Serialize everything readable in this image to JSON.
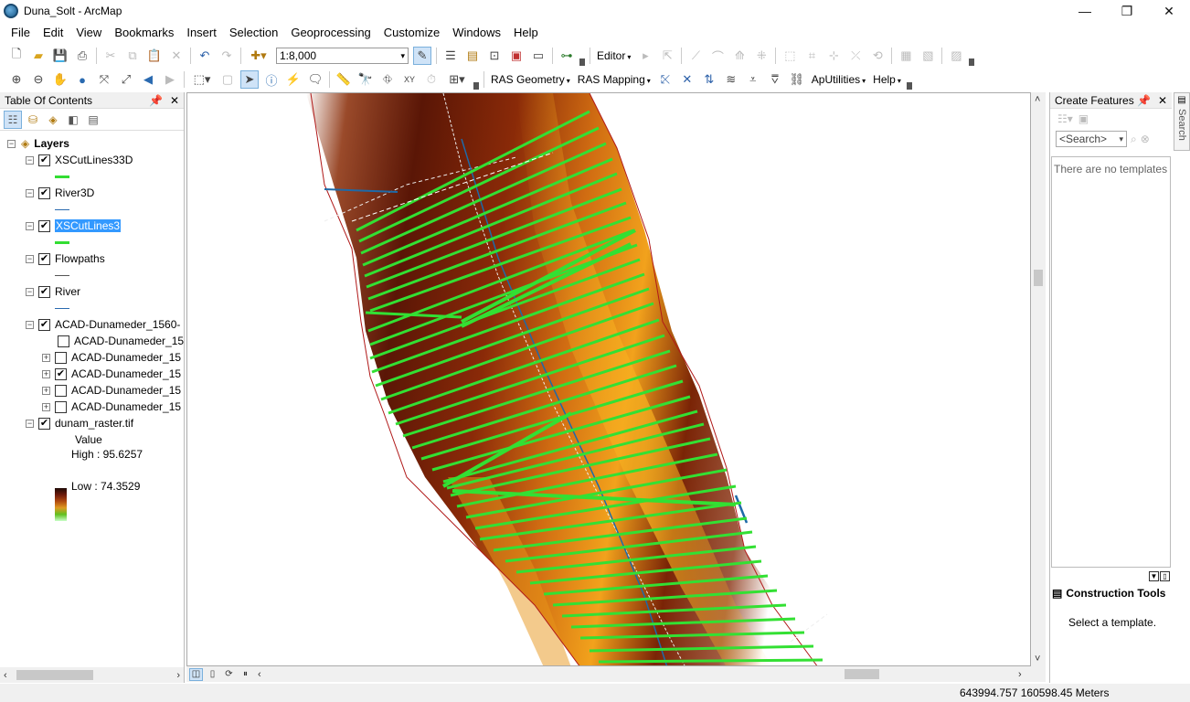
{
  "window": {
    "title": "Duna_Solt - ArcMap",
    "icon": "arcmap-globe-icon",
    "controls": {
      "minimize": "—",
      "maximize": "❐",
      "close": "✕"
    }
  },
  "menu": [
    "File",
    "Edit",
    "View",
    "Bookmarks",
    "Insert",
    "Selection",
    "Geoprocessing",
    "Customize",
    "Windows",
    "Help"
  ],
  "toolbar1": {
    "scale_value": "1:8,000",
    "editor_label": "Editor"
  },
  "toolbar2": {
    "ras_geometry": "RAS Geometry",
    "ras_mapping": "RAS Mapping",
    "aputilities": "ApUtilities",
    "help": "Help"
  },
  "toc": {
    "title": "Table Of Contents",
    "root": "Layers",
    "layers": [
      {
        "name": "XSCutLines33D",
        "checked": true,
        "swatch": "#33dd33"
      },
      {
        "name": "River3D",
        "checked": true,
        "swatch": "#2a6ab0"
      },
      {
        "name": "XSCutLines3",
        "checked": true,
        "swatch": "#33dd33",
        "selected": true
      },
      {
        "name": "Flowpaths",
        "checked": true,
        "swatch": "#555555"
      },
      {
        "name": "River",
        "checked": true,
        "swatch": "#2a6ab0"
      },
      {
        "name": "ACAD-Dunameder_1560-",
        "checked": true
      }
    ],
    "sublayers": [
      {
        "name": "ACAD-Dunameder_15",
        "checked": false,
        "expandable": false
      },
      {
        "name": "ACAD-Dunameder_15",
        "checked": false,
        "expandable": true
      },
      {
        "name": "ACAD-Dunameder_15",
        "checked": true,
        "expandable": true
      },
      {
        "name": "ACAD-Dunameder_15",
        "checked": false,
        "expandable": true
      },
      {
        "name": "ACAD-Dunameder_15",
        "checked": false,
        "expandable": true
      }
    ],
    "raster": {
      "name": "dunam_raster.tif",
      "value_label": "Value",
      "high": "High : 95.6257",
      "low": "Low : 74.3529"
    }
  },
  "create_features": {
    "title": "Create Features",
    "search_placeholder": "<Search>",
    "no_templates": "There are no templates ..",
    "construction_tools": "Construction Tools",
    "select_template": "Select a template."
  },
  "side_tab": {
    "label": "Search"
  },
  "status": {
    "coords": "643994.757  160598.45 Meters"
  },
  "colors": {
    "cutline": "#33e033",
    "river": "#1e6aa8",
    "selection": "#3399ff",
    "raster_high": "#1f0a05",
    "raster_mid": "#c0500e",
    "raster_bright": "#f2a21c"
  }
}
